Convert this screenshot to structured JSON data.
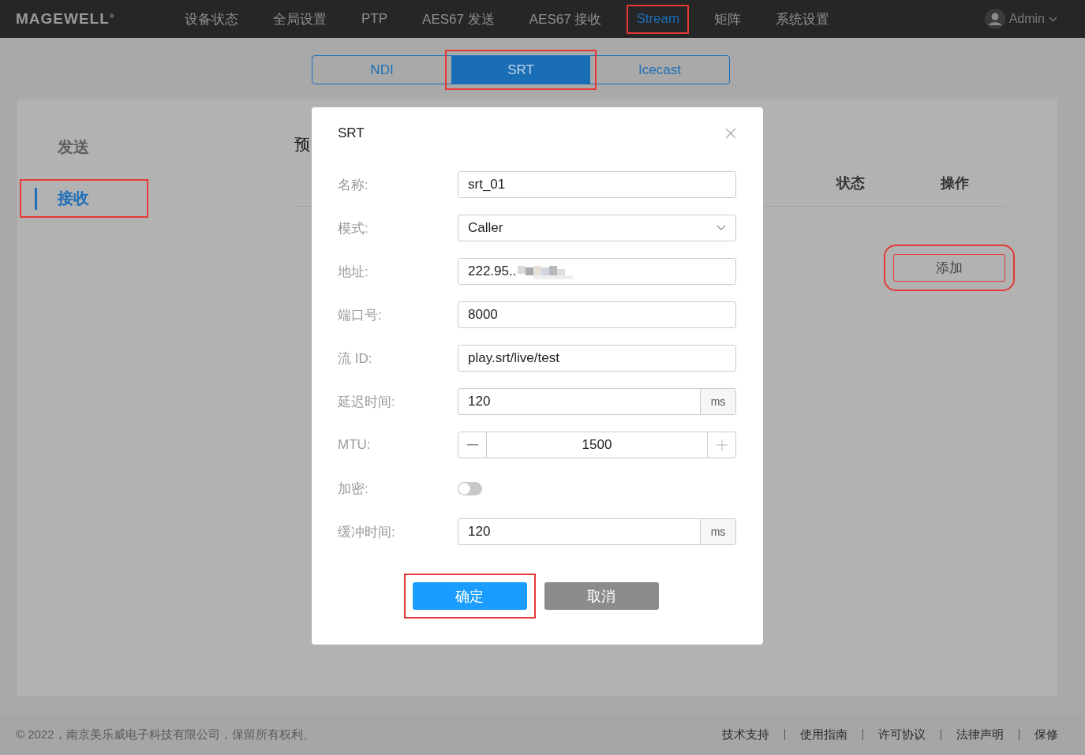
{
  "nav": {
    "logo": "MAGEWELL",
    "logo_mark": "®",
    "items": [
      {
        "label": "设备状态",
        "selected": false,
        "highlighted": false
      },
      {
        "label": "全局设置",
        "selected": false,
        "highlighted": false
      },
      {
        "label": "PTP",
        "selected": false,
        "highlighted": false
      },
      {
        "label": "AES67 发送",
        "selected": false,
        "highlighted": false
      },
      {
        "label": "AES67 接收",
        "selected": false,
        "highlighted": false
      },
      {
        "label": "Stream",
        "selected": true,
        "highlighted": true
      },
      {
        "label": "矩阵",
        "selected": false,
        "highlighted": false
      },
      {
        "label": "系统设置",
        "selected": false,
        "highlighted": false
      }
    ],
    "user": "Admin"
  },
  "tabs": [
    {
      "label": "NDI",
      "selected": false,
      "highlighted": false
    },
    {
      "label": "SRT",
      "selected": true,
      "highlighted": true
    },
    {
      "label": "Icecast",
      "selected": false,
      "highlighted": false
    }
  ],
  "sidebar": {
    "items": [
      {
        "label": "发送",
        "selected": false,
        "highlighted": false
      },
      {
        "label": "接收",
        "selected": true,
        "highlighted": true
      }
    ]
  },
  "main": {
    "title": "预",
    "columns": [
      "状态",
      "操作"
    ],
    "add_button": {
      "label": "添加",
      "highlighted": true
    }
  },
  "dialog": {
    "title": "SRT",
    "fields": [
      {
        "kind": "text",
        "label": "名称:",
        "value": "srt_01"
      },
      {
        "kind": "select",
        "label": "模式:",
        "value": "Caller"
      },
      {
        "kind": "text",
        "label": "地址:",
        "value": "222.95..",
        "blurred": true
      },
      {
        "kind": "text",
        "label": "端口号:",
        "value": "8000"
      },
      {
        "kind": "text",
        "label": "流 ID:",
        "value": "play.srt/live/test"
      },
      {
        "kind": "unit",
        "label": "延迟时间:",
        "value": "120",
        "unit": "ms"
      },
      {
        "kind": "stepper",
        "label": "MTU:",
        "value": "1500"
      },
      {
        "kind": "toggle",
        "label": "加密:",
        "on": false
      },
      {
        "kind": "unit",
        "label": "缓冲时间:",
        "value": "120",
        "unit": "ms"
      }
    ],
    "buttons": [
      {
        "label": "确定",
        "kind": "primary",
        "highlighted": true
      },
      {
        "label": "取消",
        "kind": "secondary",
        "highlighted": false
      }
    ]
  },
  "footer": {
    "copyright": "© 2022，南京美乐威电子科技有限公司，保留所有权利。",
    "links": [
      "技术支持",
      "使用指南",
      "许可协议",
      "法律声明",
      "保修"
    ]
  }
}
